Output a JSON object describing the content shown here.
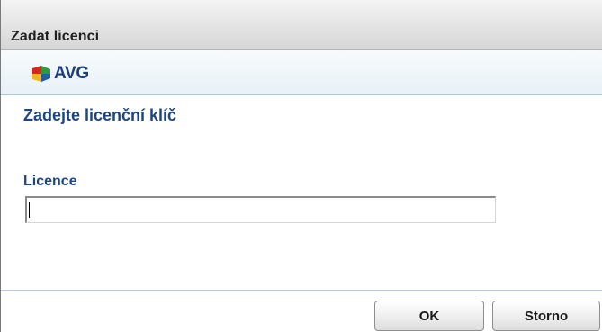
{
  "window": {
    "title": "Zadat licenci"
  },
  "brand": {
    "name": "AVG",
    "icon": "avg-logo-icon",
    "colors": {
      "text": "#1c3f7a",
      "mark_red": "#d9261c",
      "mark_green": "#2f9a3a",
      "mark_yellow": "#f2b51a",
      "mark_blue": "#1f5cae"
    }
  },
  "content": {
    "heading": "Zadejte licenční klíč",
    "license_label": "Licence",
    "license_value": "",
    "license_placeholder": ""
  },
  "buttons": {
    "ok_label": "OK",
    "cancel_label": "Storno"
  },
  "colors": {
    "heading": "#1d4680",
    "divider": "#b7ccdc"
  }
}
